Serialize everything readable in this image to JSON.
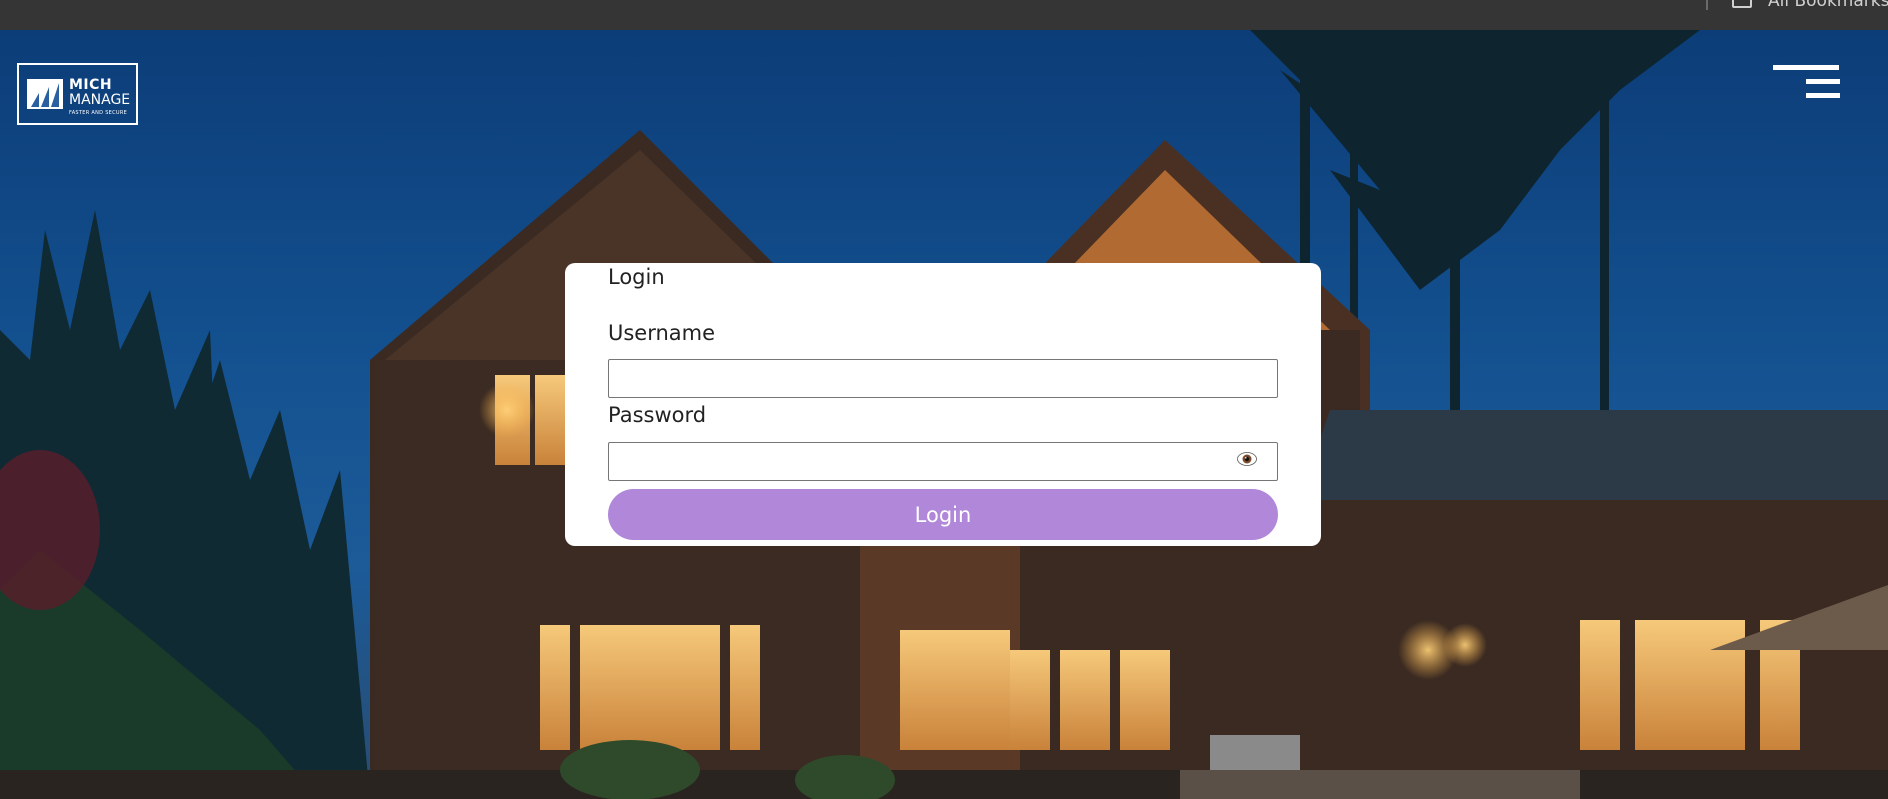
{
  "browser": {
    "bookmarks_label": "All Bookmarks"
  },
  "brand": {
    "name_top": "MICH",
    "name_bottom": "MANAGE",
    "tagline": "FASTER AND SECURE"
  },
  "nav": {
    "menu_icon": "hamburger-icon"
  },
  "login": {
    "title": "Login",
    "username_label": "Username",
    "username_value": "",
    "password_label": "Password",
    "password_value": "",
    "toggle_icon": "eye-icon",
    "submit_label": "Login"
  },
  "colors": {
    "browser_bar": "#353535",
    "card_bg": "#ffffff",
    "button_bg": "#b087d9",
    "button_text": "#ffffff"
  }
}
